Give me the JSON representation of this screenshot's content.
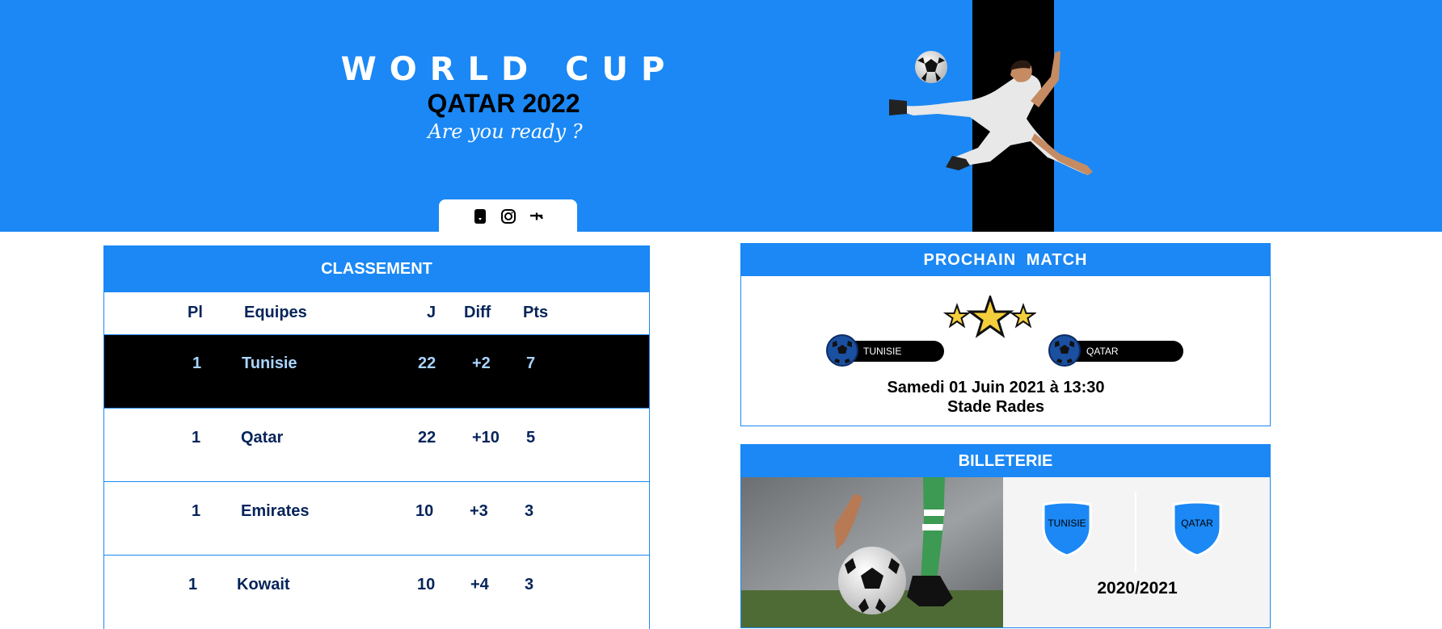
{
  "header": {
    "title": "WORLD CUP",
    "subtitle": "QATAR 2022",
    "tagline": "Are you ready ?",
    "social_icons": [
      "facebook-icon",
      "instagram-icon",
      "twitter-icon"
    ]
  },
  "colors": {
    "primary": "#1b88f5",
    "dark": "#000000",
    "text_dark": "#06245a",
    "active_text": "#a9d4ff"
  },
  "classement": {
    "title": "CLASSEMENT",
    "columns": {
      "pl": "Pl",
      "team": "Equipes",
      "j": "J",
      "diff": "Diff",
      "pts": "Pts"
    },
    "rows": [
      {
        "pl": "1",
        "team": "Tunisie",
        "j": "22",
        "diff": "+2",
        "pts": "7"
      },
      {
        "pl": "1",
        "team": "Qatar",
        "j": "22",
        "diff": "+10",
        "pts": "5"
      },
      {
        "pl": "1",
        "team": "Emirates",
        "j": "10",
        "diff": "+3",
        "pts": "3"
      },
      {
        "pl": "1",
        "team": "Kowait",
        "j": "10",
        "diff": "+4",
        "pts": "3"
      }
    ]
  },
  "prochain_match": {
    "title": "PROCHAIN  MATCH",
    "home": "TUNISIE",
    "away": "QATAR",
    "date": "Samedi 01 Juin 2021 à 13:30",
    "venue": "Stade Rades"
  },
  "billeterie": {
    "title": "BILLETERIE",
    "home": "TUNISIE",
    "away": "QATAR",
    "season": "2020/2021"
  }
}
